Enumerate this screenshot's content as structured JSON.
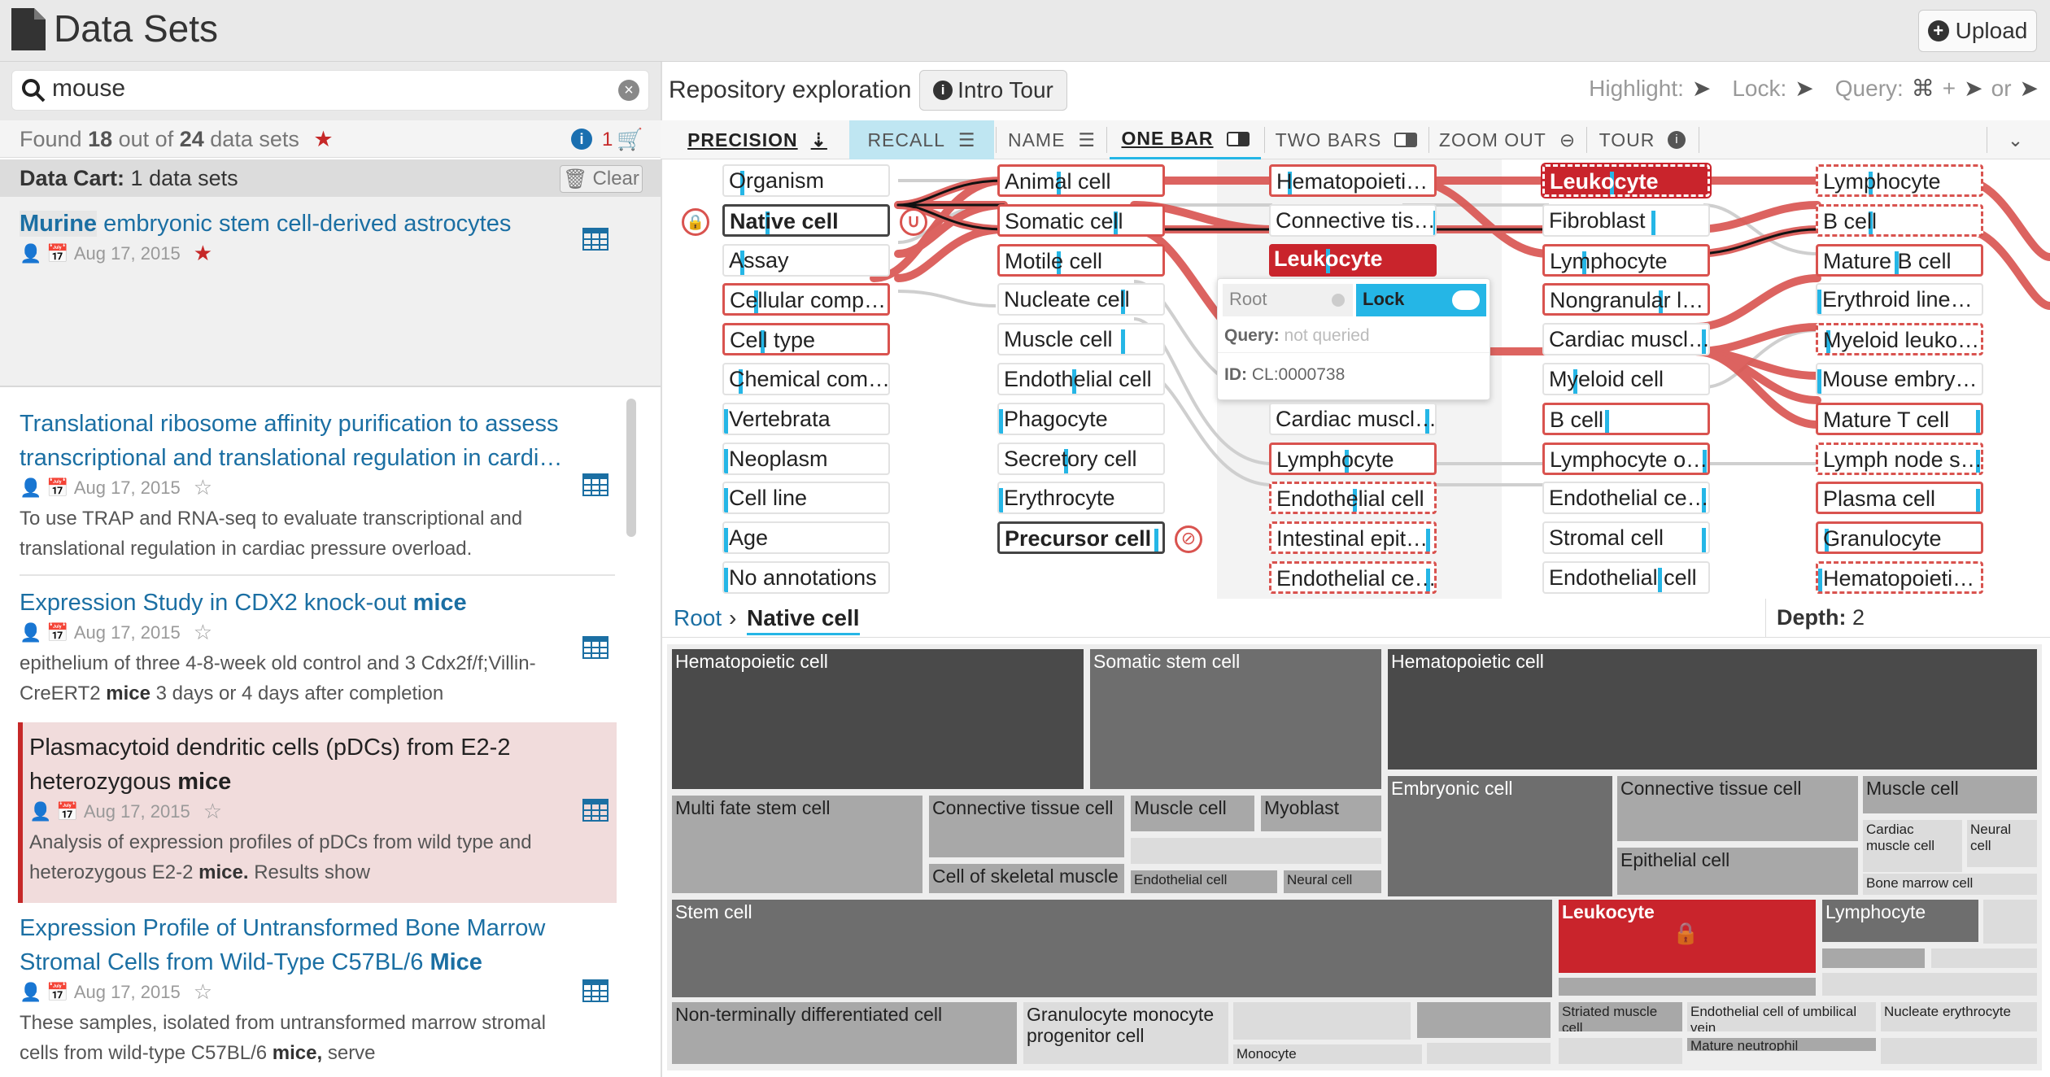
{
  "app": {
    "title": "Data Sets",
    "upload_label": "Upload"
  },
  "search": {
    "value": "mouse"
  },
  "found": {
    "prefix": "Found",
    "count": "18",
    "mid": "out of",
    "total": "24",
    "suffix": "data sets",
    "cart_count": "1"
  },
  "cart": {
    "label": "Data Cart:",
    "value": "1 data sets",
    "clear_label": "Clear"
  },
  "datasets": [
    {
      "title_hl": "Murine",
      "title_rest": "embryonic stem cell-derived astrocytes",
      "date": "Aug 17, 2015",
      "starred": true
    },
    {
      "title": "Translational ribosome affinity purification to assess transcriptional and translational regulation in cardi…",
      "date": "Aug 17, 2015",
      "desc": "To use TRAP and RNA-seq to evaluate transcriptional and translational regulation in cardiac pressure overload."
    },
    {
      "title_a": "Expression Study in CDX2 knock-out",
      "title_hl": "mice",
      "date": "Aug 17, 2015",
      "desc_a": "epithelium of three 4-8-week old control and 3 Cdx2f/f;Villin-CreERT2",
      "desc_hl": "mice",
      "desc_b": "3 days or 4 days after completion"
    },
    {
      "title_a": "Plasmacytoid dendritic cells (pDCs) from E2-2 heterozygous",
      "title_hl": "mice",
      "date": "Aug 17, 2015",
      "desc_a": "Analysis of expression profiles of pDCs from wild type and heterozygous E2-2",
      "desc_hl": "mice.",
      "desc_b": "Results show"
    },
    {
      "title_a": "Expression Profile of Untransformed Bone Marrow Stromal Cells from Wild-Type C57BL/6",
      "title_hl": "Mice",
      "date": "Aug 17, 2015",
      "desc_a": "These samples, isolated from untransformed marrow stromal cells from wild-type C57BL/6",
      "desc_hl": "mice,",
      "desc_b": "serve"
    }
  ],
  "explore": {
    "label": "Repository exploration",
    "tour_label": "Intro Tour",
    "highlight": "Highlight:",
    "lock": "Lock:",
    "query": "Query:",
    "plus": "+",
    "or": "or"
  },
  "toolbar": {
    "precision": "PRECISION",
    "recall": "RECALL",
    "name": "NAME",
    "one_bar": "ONE BAR",
    "two_bars": "TWO BARS",
    "zoom_out": "ZOOM OUT",
    "tour": "TOUR"
  },
  "graph": {
    "col1": [
      "Organism",
      "Native cell",
      "Assay",
      "Cellular comp…",
      "Cell type",
      "Chemical com…",
      "Vertebrata",
      "Neoplasm",
      "Cell line",
      "Age",
      "No annotations"
    ],
    "col2": [
      "Animal cell",
      "Somatic cell",
      "Motile cell",
      "Nucleate cell",
      "Muscle cell",
      "Endothelial cell",
      "Phagocyte",
      "Secretory cell",
      "Erythrocyte",
      "Precursor cell"
    ],
    "col3": [
      "Hematopoieti…",
      "Connective tis…",
      "Leukocyte",
      "Cardiac muscl…",
      "Lymphocyte",
      "Endothelial cell",
      "Intestinal epit…",
      "Endothelial ce…"
    ],
    "col4": [
      "Leukocyte",
      "Fibroblast",
      "Lymphocyte",
      "Nongranular l…",
      "Cardiac muscl…",
      "Myeloid cell",
      "B cell",
      "Lymphocyte o…",
      "Endothelial ce…",
      "Stromal cell",
      "Endothelial cell"
    ],
    "col5": [
      "Lymphocyte",
      "B cell",
      "Mature B cell",
      "Erythroid line…",
      "Myeloid leuko…",
      "Mouse embry…",
      "Mature T cell",
      "Lymph node s…",
      "Plasma cell",
      "Granulocyte",
      "Hematopoieti…"
    ]
  },
  "popup": {
    "root": "Root",
    "lock": "Lock",
    "query_label": "Query:",
    "query_value": "not queried",
    "id_label": "ID:",
    "id_value": "CL:0000738"
  },
  "breadcrumb": {
    "root": "Root",
    "sep": "›",
    "current": "Native cell"
  },
  "depth": {
    "label": "Depth:",
    "value": "2"
  },
  "treemap": {
    "hematopoietic_1": "Hematopoietic cell",
    "somatic_stem": "Somatic stem cell",
    "hematopoietic_2": "Hematopoietic cell",
    "multi_fate": "Multi fate stem cell",
    "connective_1": "Connective tissue cell",
    "muscle_1": "Muscle cell",
    "myoblast": "Myoblast",
    "skeletal": "Cell of skeletal muscle",
    "endo_small": "Endothelial cell",
    "neural_small": "Neural cell",
    "embryonic": "Embryonic cell",
    "connective_2": "Connective tissue cell",
    "muscle_2": "Muscle cell",
    "cardiac": "Cardiac muscle cell",
    "neural_2": "Neural cell",
    "epithelial": "Epithelial cell",
    "bone_marrow": "Bone marrow cell",
    "stem": "Stem cell",
    "leukocyte": "Leukocyte",
    "lymphocyte": "Lymphocyte",
    "non_term": "Non-terminally differentiated cell",
    "gran_mono": "Granulocyte monocyte progenitor cell",
    "monocyte": "Monocyte",
    "striated": "Striated muscle cell",
    "endo_umb": "Endothelial cell of umbilical vein",
    "mature_neut": "Mature neutrophil",
    "nucleate_ery": "Nucleate erythrocyte"
  },
  "colors": {
    "accent_blue": "#25b6e6",
    "lock_red": "#c9242c",
    "link_blue": "#1b6fa3"
  }
}
